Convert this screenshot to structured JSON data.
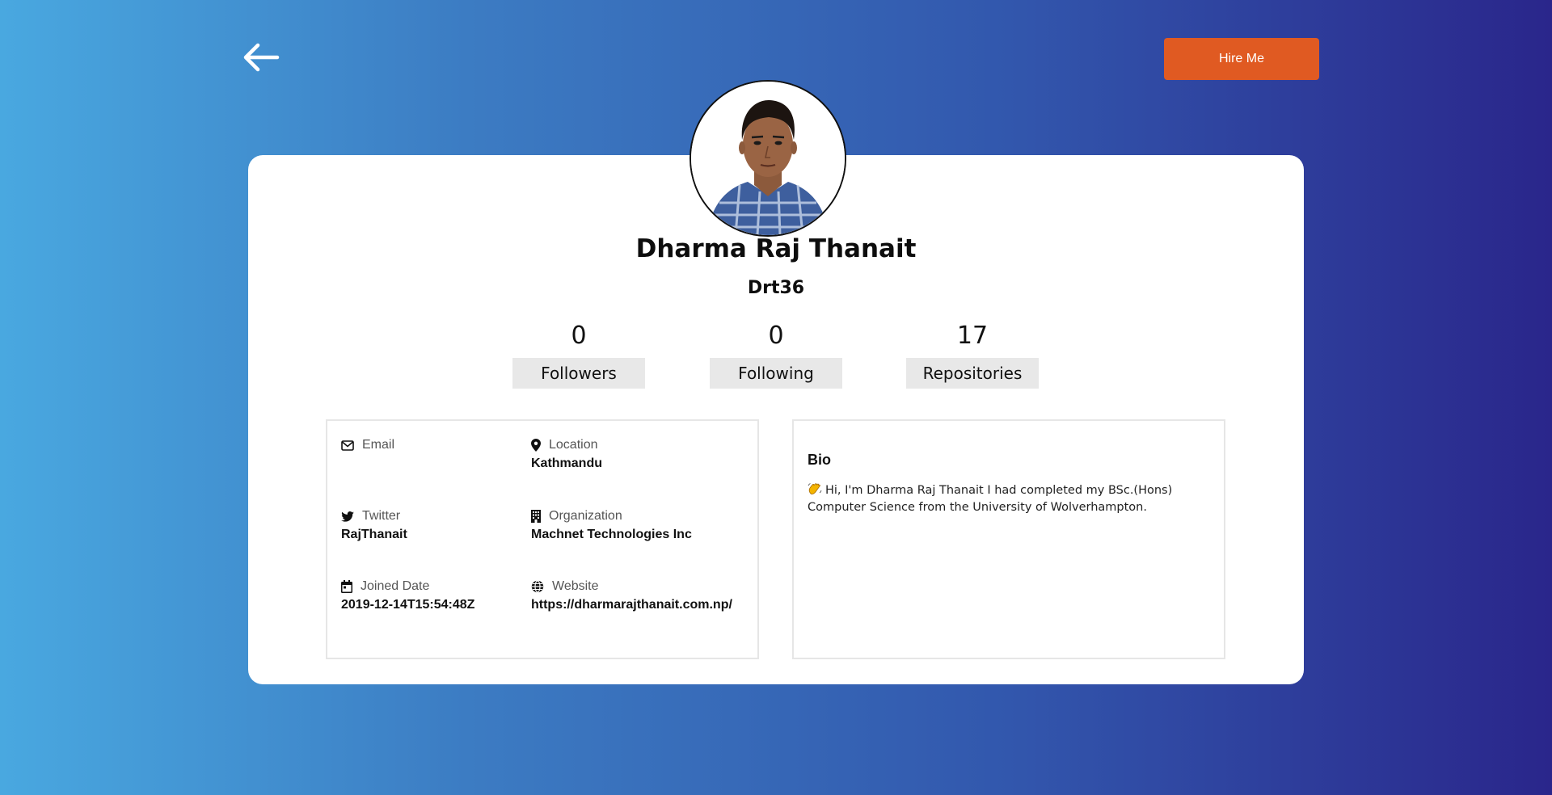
{
  "header": {
    "back_icon": "arrow-left-icon",
    "hire_label": "Hire Me",
    "hire_color": "#e05a22"
  },
  "profile": {
    "name": "Dharma Raj Thanait",
    "login": "Drt36",
    "avatar_icon": "user-avatar"
  },
  "stats": [
    {
      "value": "0",
      "label": "Followers"
    },
    {
      "value": "0",
      "label": "Following"
    },
    {
      "value": "17",
      "label": "Repositories"
    }
  ],
  "info": {
    "email": {
      "label": "Email",
      "value": "",
      "icon": "envelope-icon"
    },
    "location": {
      "label": "Location",
      "value": "Kathmandu",
      "icon": "map-pin-icon"
    },
    "twitter": {
      "label": "Twitter",
      "value": "RajThanait",
      "icon": "twitter-icon"
    },
    "organization": {
      "label": "Organization",
      "value": "Machnet Technologies Inc",
      "icon": "building-icon"
    },
    "joined": {
      "label": "Joined Date",
      "value": "2019-12-14T15:54:48Z",
      "icon": "calendar-icon"
    },
    "website": {
      "label": "Website",
      "value": "https://dharmarajthanait.com.np/",
      "icon": "globe-icon"
    }
  },
  "bio": {
    "title": "Bio",
    "text": "Hi, I'm Dharma Raj Thanait I had completed my BSc.(Hons) Computer Science from the University of Wolverhampton.",
    "emoji_icon": "waving-hand-icon"
  }
}
